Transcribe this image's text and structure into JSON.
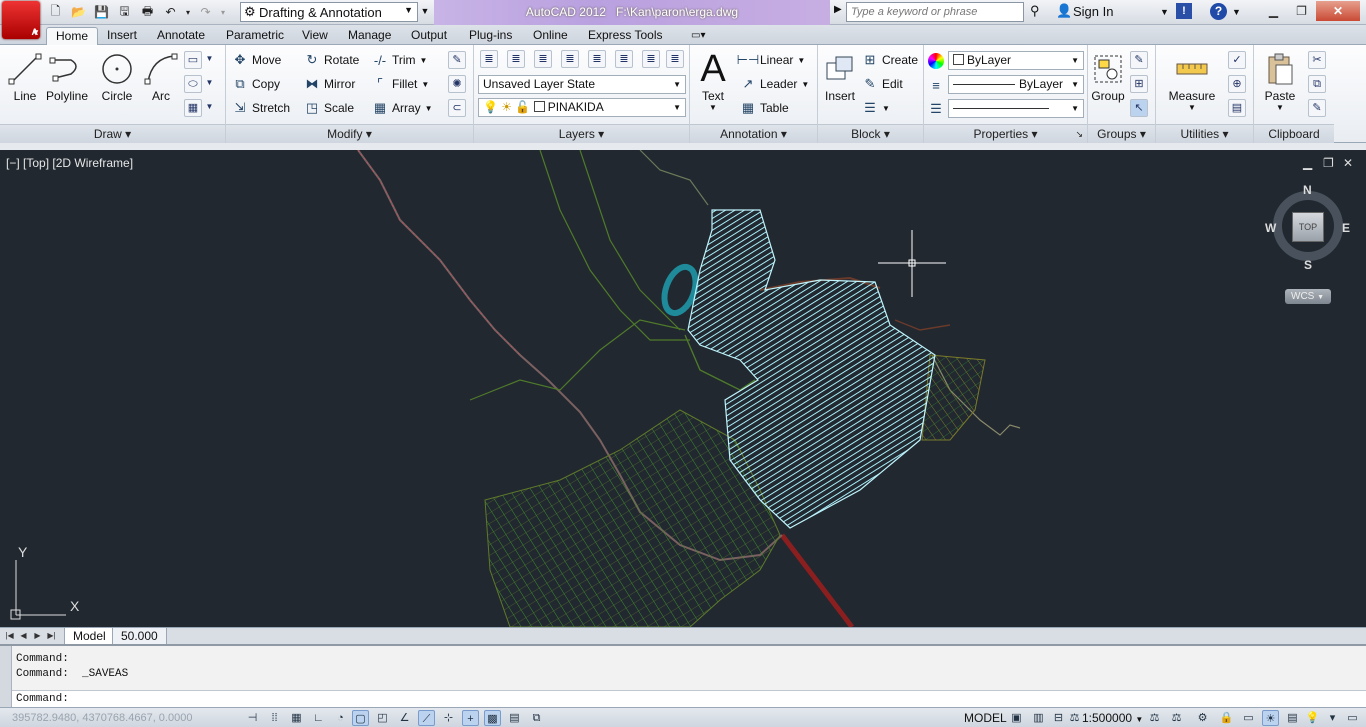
{
  "app": {
    "logo_letter": "A",
    "title": "AutoCAD 2012",
    "file_path": "F:\\Kan\\paron\\erga.dwg"
  },
  "titlebar": {
    "workspace": "Drafting & Annotation",
    "search_placeholder": "Type a keyword or phrase",
    "sign_in": "Sign In",
    "help_glyph": "?"
  },
  "tabs": [
    "Home",
    "Insert",
    "Annotate",
    "Parametric",
    "View",
    "Manage",
    "Output",
    "Plug-ins",
    "Online",
    "Express Tools"
  ],
  "ribbon": {
    "draw": {
      "title": "Draw",
      "line": "Line",
      "polyline": "Polyline",
      "circle": "Circle",
      "arc": "Arc"
    },
    "modify": {
      "title": "Modify",
      "move": "Move",
      "rotate": "Rotate",
      "trim": "Trim",
      "copy": "Copy",
      "mirror": "Mirror",
      "fillet": "Fillet",
      "stretch": "Stretch",
      "scale": "Scale",
      "array": "Array"
    },
    "layers": {
      "title": "Layers",
      "layer_state": "Unsaved Layer State",
      "current_layer": "PINAKIDA"
    },
    "annotation": {
      "title": "Annotation",
      "text": "Text",
      "linear": "Linear",
      "leader": "Leader",
      "table": "Table"
    },
    "block": {
      "title": "Block",
      "insert": "Insert",
      "create": "Create",
      "edit": "Edit"
    },
    "properties": {
      "title": "Properties",
      "color": "ByLayer",
      "linetype": "ByLayer",
      "lineweight": ""
    },
    "groups": {
      "title": "Groups",
      "group": "Group"
    },
    "utilities": {
      "title": "Utilities",
      "measure": "Measure"
    },
    "clipboard": {
      "title": "Clipboard",
      "paste": "Paste"
    }
  },
  "viewport": {
    "label": "[−] [Top] [2D Wireframe]",
    "viewcube": {
      "n": "N",
      "s": "S",
      "e": "E",
      "w": "W",
      "top": "TOP",
      "wcs": "WCS"
    },
    "ucs": {
      "x": "X",
      "y": "Y"
    }
  },
  "layout_tabs": {
    "model": "Model",
    "layout": "50.000"
  },
  "command": {
    "history": [
      "Command:",
      "Command:  _SAVEAS"
    ],
    "prompt": "Command:"
  },
  "status": {
    "coordinates": "395782.9480, 4370768.4667, 0.0000",
    "space": "MODEL",
    "scale": "1:500000"
  },
  "colors": {
    "hatch": "#9fe9f4",
    "background": "#212830",
    "roads": "#6b8a3a",
    "parcels": "#2f8f2f",
    "highway": "#8b1f1f",
    "accent": "#cc2222"
  }
}
